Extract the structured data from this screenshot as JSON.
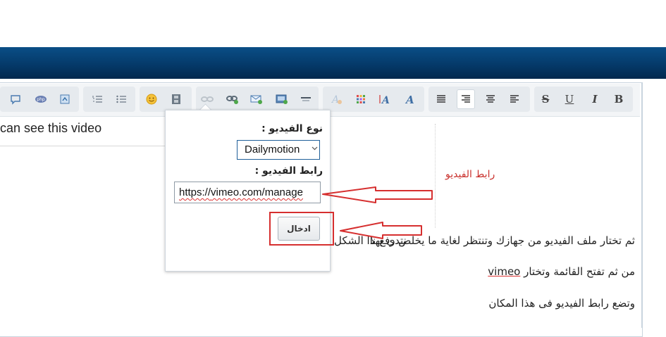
{
  "editor": {
    "content_text": "can see this video",
    "annotation": "رابط الفيديو",
    "paragraphs": {
      "line1": "ثم تختار ملف الفيديو من جهازك وتنتظر لغاية ما يخلص رفع نا",
      "line1_right_fragment": "نتدي بهذا الشكل",
      "line2_prefix": "من ثم تفتح القائمة وتختار ",
      "line2_link": "vimeo",
      "line3": "وتضع رابط الفيديو فى هذا المكان"
    }
  },
  "toolbar": {
    "bold": "B",
    "italic": "I",
    "underline": "U",
    "strike": "S"
  },
  "video_dialog": {
    "type_label": "نوع الفيديو :",
    "type_value": "Dailymotion",
    "url_label": "رابط الفيديو :",
    "url_value_prefix": "https://",
    "url_value_rest": "vimeo.com/manage",
    "submit_label": "ادخال"
  },
  "colors": {
    "header": "#053a6a",
    "annotation_red": "#d62f2f"
  }
}
